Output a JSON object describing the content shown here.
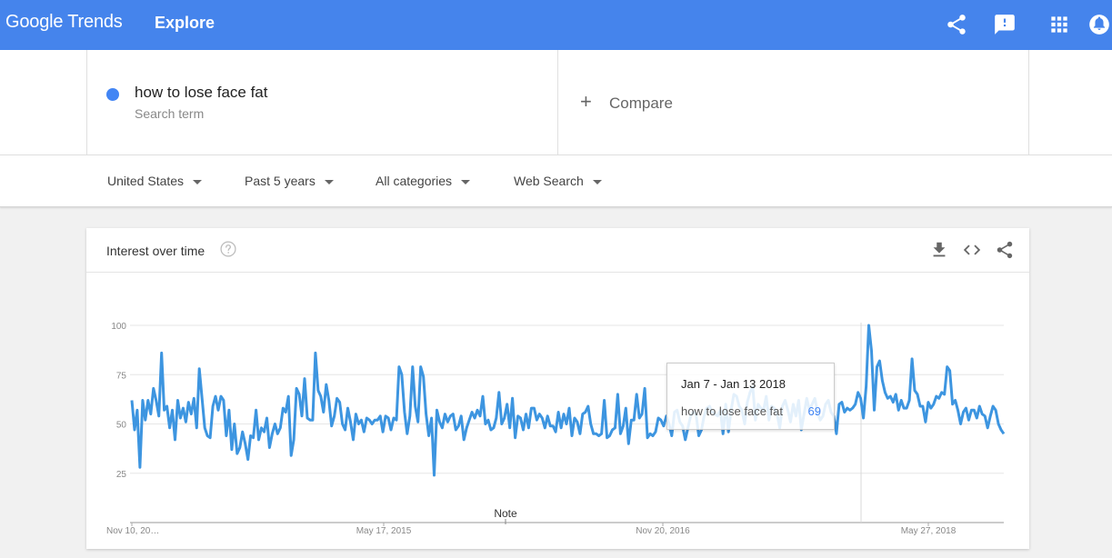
{
  "header": {
    "logo": "Google Trends",
    "section": "Explore",
    "icons": [
      "share-icon",
      "feedback-icon",
      "apps-icon",
      "notifications-icon"
    ]
  },
  "search": {
    "term": "how to lose face fat",
    "term_sublabel": "Search term",
    "term_color": "#4285f4",
    "compare_label": "Compare"
  },
  "filters": {
    "region": "United States",
    "time_range": "Past 5 years",
    "category": "All categories",
    "search_type": "Web Search"
  },
  "card": {
    "title": "Interest over time",
    "icons": [
      "help-icon",
      "download-icon",
      "embed-icon",
      "share-icon"
    ]
  },
  "tooltip": {
    "date_range": "Jan 7 - Jan 13 2018",
    "term": "how to lose face fat",
    "value": "69"
  },
  "chart_data": {
    "type": "line",
    "title": "Interest over time",
    "x_tick_labels": [
      "Nov 10, 20…",
      "May 17, 2015",
      "Nov 20, 2016",
      "May 27, 2018"
    ],
    "y_tick_labels": [
      "100",
      "75",
      "50",
      "25"
    ],
    "ylim": [
      0,
      100
    ],
    "grid": true,
    "annotation": "Note",
    "series": [
      {
        "name": "how to lose face fat",
        "color": "#4285f4",
        "values": [
          62,
          47,
          57,
          28,
          62,
          52,
          62,
          55,
          68,
          62,
          54,
          86,
          57,
          59,
          48,
          57,
          42,
          62,
          53,
          58,
          51,
          61,
          55,
          63,
          48,
          78,
          63,
          48,
          44,
          43,
          59,
          64,
          57,
          64,
          62,
          44,
          57,
          37,
          50,
          35,
          38,
          46,
          40,
          32,
          44,
          43,
          57,
          42,
          48,
          46,
          53,
          38,
          45,
          50,
          45,
          48,
          58,
          56,
          64,
          34,
          42,
          68,
          65,
          54,
          73,
          53,
          52,
          52,
          86,
          67,
          64,
          56,
          70,
          62,
          49,
          54,
          63,
          61,
          50,
          47,
          58,
          51,
          42,
          55,
          50,
          52,
          46,
          53,
          52,
          50,
          52,
          52,
          54,
          46,
          54,
          53,
          47,
          53,
          52,
          79,
          75,
          56,
          45,
          54,
          79,
          59,
          51,
          79,
          74,
          55,
          44,
          53,
          24,
          57,
          51,
          48,
          55,
          51,
          54,
          55,
          47,
          49,
          54,
          42,
          48,
          52,
          56,
          53,
          57,
          54,
          64,
          50,
          52,
          47,
          48,
          53,
          66,
          50,
          53,
          60,
          48,
          63,
          43,
          54,
          53,
          47,
          55,
          48,
          58,
          58,
          52,
          55,
          53,
          48,
          54,
          49,
          49,
          46,
          56,
          48,
          55,
          50,
          58,
          44,
          53,
          51,
          45,
          55,
          56,
          59,
          50,
          45,
          45,
          44,
          45,
          62,
          43,
          44,
          47,
          48,
          65,
          45,
          49,
          58,
          40,
          52,
          52,
          65,
          53,
          55,
          68,
          43,
          45,
          44,
          46,
          53,
          52,
          49,
          54,
          50,
          44,
          56,
          57,
          51,
          49,
          42,
          48,
          54,
          56,
          55,
          44,
          47,
          54,
          58,
          59,
          56,
          55,
          54,
          57,
          45,
          60,
          46,
          57,
          65,
          64,
          59,
          57,
          50,
          61,
          66,
          69,
          52,
          60,
          58,
          57,
          64,
          52,
          59,
          58,
          55,
          48,
          59,
          62,
          57,
          51,
          60,
          54,
          62,
          47,
          55,
          63,
          57,
          60,
          63,
          56,
          52,
          54,
          60,
          62,
          56,
          54,
          45,
          60,
          61,
          56,
          58,
          57,
          58,
          60,
          66,
          63,
          53,
          69,
          100,
          87,
          57,
          79,
          82,
          72,
          66,
          63,
          64,
          61,
          65,
          57,
          62,
          58,
          58,
          62,
          83,
          67,
          65,
          59,
          59,
          51,
          61,
          58,
          60,
          64,
          63,
          66,
          65,
          79,
          77,
          60,
          62,
          57,
          50,
          56,
          58,
          52,
          57,
          57,
          53,
          59,
          55,
          54,
          48,
          54,
          59,
          57,
          50,
          47,
          45
        ]
      }
    ]
  }
}
